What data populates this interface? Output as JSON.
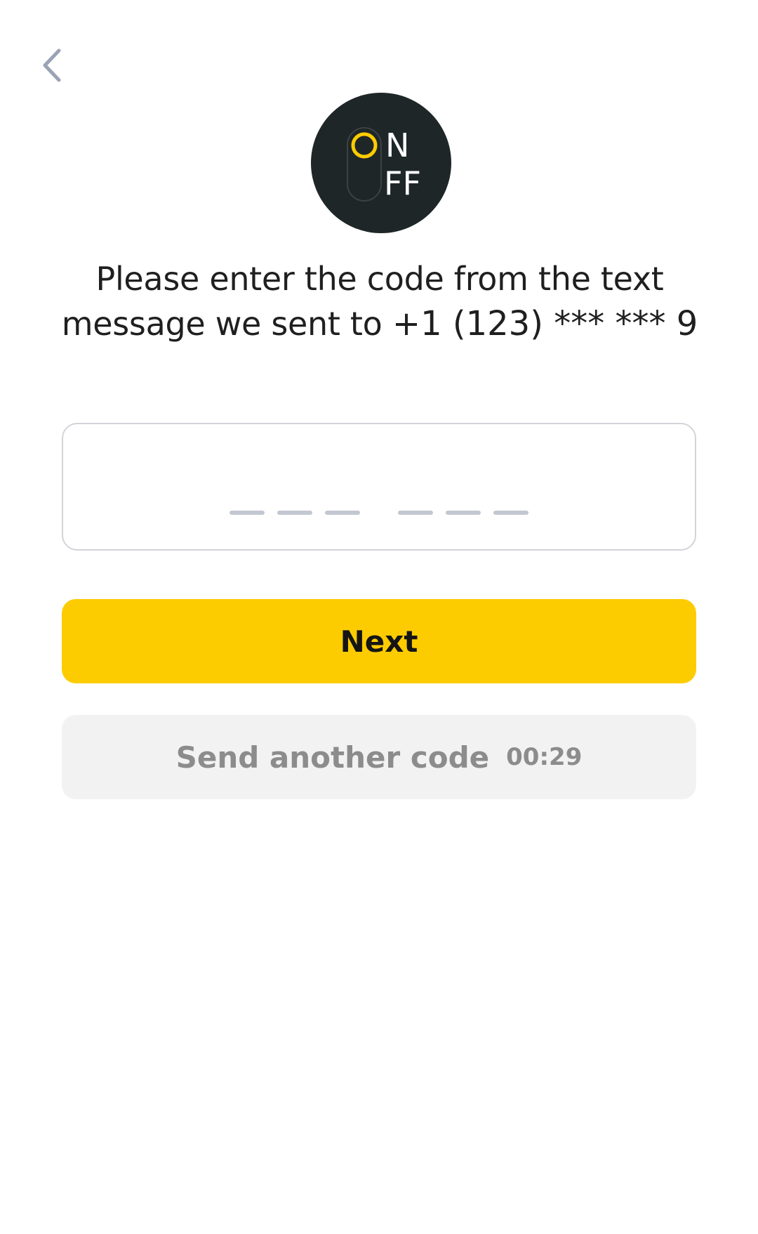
{
  "header": {
    "back_icon": "chevron-left-icon"
  },
  "logo": {
    "top_text": "N",
    "bottom_text": "FF",
    "icon": "on-off-toggle-icon",
    "background_color": "#1f2628",
    "accent_color": "#fdcc00"
  },
  "prompt": {
    "text": "Please enter the code from the text message we sent to",
    "phone": "+1 (123) *** *** 9"
  },
  "code_input": {
    "value": "",
    "digits": 6
  },
  "next_button": {
    "label": "Next",
    "color": "#fdcc00"
  },
  "resend_button": {
    "label": "Send another code",
    "timer": "00:29"
  }
}
